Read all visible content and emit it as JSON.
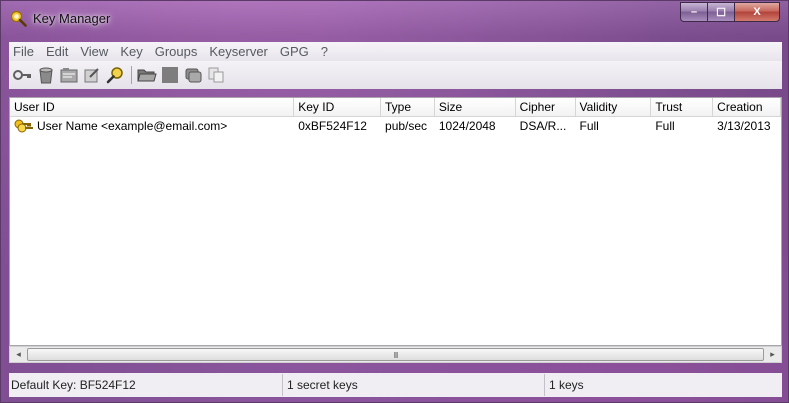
{
  "window": {
    "title": "Key Manager",
    "minimize_glyph": "–",
    "maximize_glyph": "☐",
    "close_glyph": "X"
  },
  "menu": [
    "File",
    "Edit",
    "View",
    "Key",
    "Groups",
    "Keyserver",
    "GPG",
    "?"
  ],
  "toolbar": {
    "buttons": [
      "key-icon",
      "trash-icon",
      "properties-icon",
      "sign-icon",
      "search-icon",
      "open-folder-icon",
      "save-icon",
      "copy-icon",
      "paste-icon"
    ]
  },
  "table": {
    "columns": [
      "User ID",
      "Key ID",
      "Type",
      "Size",
      "Cipher",
      "Validity",
      "Trust",
      "Creation"
    ],
    "rows": [
      {
        "user_id": "User Name <example@email.com>",
        "key_id": "0xBF524F12",
        "type": "pub/sec",
        "size": "1024/2048",
        "cipher": "DSA/R...",
        "validity": "Full",
        "trust": "Full",
        "creation": "3/13/2013"
      }
    ]
  },
  "scrollbar": {
    "left_arrow": "◂",
    "right_arrow": "▸",
    "grip": "III"
  },
  "status": {
    "default_key": "Default Key: BF524F12",
    "secret_keys": "1 secret keys",
    "keys": "1 keys"
  },
  "colors": {
    "title_gradient": "#a878be",
    "accent_key": "#e0b020"
  }
}
